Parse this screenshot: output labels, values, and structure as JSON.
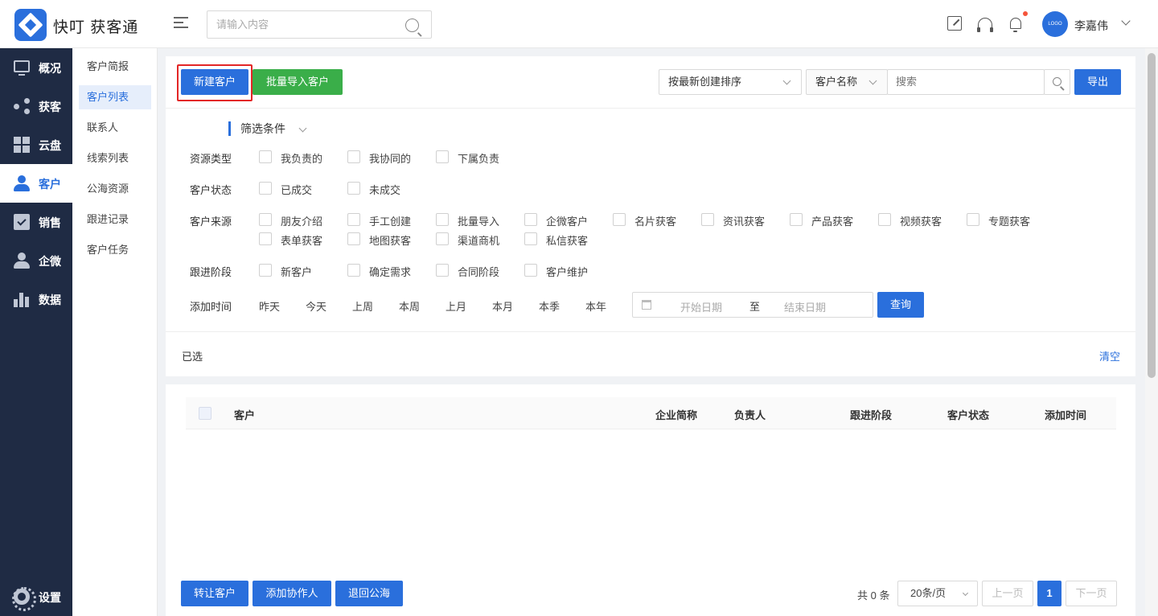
{
  "app": {
    "title": "快叮 获客通"
  },
  "header": {
    "search_placeholder": "请输入内容",
    "username": "李嘉伟",
    "avatar_text": "LOGO"
  },
  "nav": {
    "items": [
      {
        "label": "概况",
        "icon": "monitor-icon"
      },
      {
        "label": "获客",
        "icon": "share-icon"
      },
      {
        "label": "云盘",
        "icon": "grid-icon"
      },
      {
        "label": "客户",
        "icon": "user-icon",
        "active": true
      },
      {
        "label": "销售",
        "icon": "clipboard-icon"
      },
      {
        "label": "企微",
        "icon": "user-icon"
      },
      {
        "label": "数据",
        "icon": "bar-chart-icon"
      }
    ],
    "settings_label": "设置"
  },
  "subnav": {
    "items": [
      "客户简报",
      "客户列表",
      "联系人",
      "线索列表",
      "公海资源",
      "跟进记录",
      "客户任务"
    ],
    "active": "客户列表"
  },
  "toolbar": {
    "new_customer": "新建客户",
    "batch_import": "批量导入客户",
    "sort_select": "按最新创建排序",
    "field_select": "客户名称",
    "search_placeholder": "搜索",
    "export": "导出"
  },
  "filters": {
    "title": "筛选条件",
    "resource_type": {
      "label": "资源类型",
      "options": [
        "我负责的",
        "我协同的",
        "下属负责"
      ]
    },
    "customer_status": {
      "label": "客户状态",
      "options": [
        "已成交",
        "未成交"
      ]
    },
    "customer_source": {
      "label": "客户来源",
      "options": [
        "朋友介绍",
        "手工创建",
        "批量导入",
        "企微客户",
        "名片获客",
        "资讯获客",
        "产品获客",
        "视频获客",
        "专题获客",
        "表单获客",
        "地图获客",
        "渠道商机",
        "私信获客"
      ]
    },
    "follow_stage": {
      "label": "跟进阶段",
      "options": [
        "新客户",
        "确定需求",
        "合同阶段",
        "客户维护"
      ]
    },
    "add_time": {
      "label": "添加时间",
      "options": [
        "昨天",
        "今天",
        "上周",
        "本周",
        "上月",
        "本月",
        "本季",
        "本年"
      ],
      "start_placeholder": "开始日期",
      "separator": "至",
      "end_placeholder": "结束日期",
      "query": "查询"
    }
  },
  "selected": {
    "label": "已选",
    "clear": "清空"
  },
  "table": {
    "columns": [
      "客户",
      "企业简称",
      "负责人",
      "跟进阶段",
      "客户状态",
      "添加时间"
    ],
    "rows": []
  },
  "footer": {
    "transfer": "转让客户",
    "add_collaborator": "添加协作人",
    "return_pool": "退回公海",
    "total": "共 0 条",
    "page_size": "20条/页",
    "prev": "上一页",
    "current_page": "1",
    "next": "下一页"
  },
  "colors": {
    "primary": "#2a6fdc",
    "success": "#3aae49",
    "nav_bg": "#1f2b44",
    "highlight": "#e32626"
  }
}
